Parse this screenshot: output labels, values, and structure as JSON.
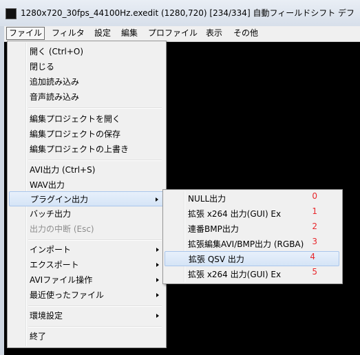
{
  "window": {
    "title": "1280x720_30fps_44100Hz.exedit (1280,720)  [234/334]  自動フィールドシフト デフ"
  },
  "menubar": [
    {
      "label": "ファイル"
    },
    {
      "label": "フィルタ"
    },
    {
      "label": "設定"
    },
    {
      "label": "編集"
    },
    {
      "label": "プロファイル"
    },
    {
      "label": "表示"
    },
    {
      "label": "その他"
    }
  ],
  "file_menu": {
    "items": [
      {
        "label": "開く (Ctrl+O)"
      },
      {
        "label": "閉じる"
      },
      {
        "label": "追加読み込み"
      },
      {
        "label": "音声読み込み"
      },
      {
        "label": "編集プロジェクトを開く"
      },
      {
        "label": "編集プロジェクトの保存"
      },
      {
        "label": "編集プロジェクトの上書き"
      },
      {
        "label": "AVI出力 (Ctrl+S)"
      },
      {
        "label": "WAV出力"
      },
      {
        "label": "プラグイン出力"
      },
      {
        "label": "バッチ出力"
      },
      {
        "label": "出力の中断 (Esc)"
      },
      {
        "label": "インポート"
      },
      {
        "label": "エクスポート"
      },
      {
        "label": "AVIファイル操作"
      },
      {
        "label": "最近使ったファイル"
      },
      {
        "label": "環境設定"
      },
      {
        "label": "終了"
      }
    ]
  },
  "plugin_submenu": {
    "items": [
      {
        "label": "NULL出力",
        "index": "0"
      },
      {
        "label": "拡張 x264 出力(GUI) Ex",
        "index": "1"
      },
      {
        "label": "連番BMP出力",
        "index": "2"
      },
      {
        "label": "拡張編集AVI/BMP出力 (RGBA)",
        "index": "3"
      },
      {
        "label": "拡張 QSV 出力",
        "index": "4"
      },
      {
        "label": "拡張 x264 出力(GUI) Ex",
        "index": "5"
      }
    ]
  },
  "colors": {
    "highlight": "#d5e4f6",
    "index_text": "#e8262b",
    "canvas": "#000000"
  }
}
